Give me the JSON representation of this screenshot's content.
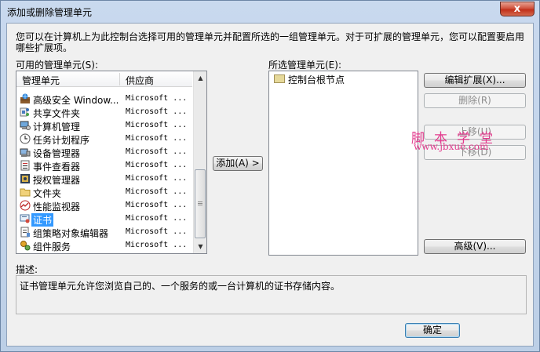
{
  "window": {
    "title": "添加或删除管理单元",
    "close_label": "x"
  },
  "intro": "您可以在计算机上为此控制台选择可用的管理单元并配置所选的一组管理单元。对于可扩展的管理单元，您可以配置要启用哪些扩展项。",
  "available": {
    "label": "可用的管理单元(S):",
    "columns": [
      "管理单元",
      "供应商"
    ],
    "items": [
      {
        "name": "高级安全 Window...",
        "vendor": "Microsoft ...",
        "icon": "firewall-icon"
      },
      {
        "name": "共享文件夹",
        "vendor": "Microsoft ...",
        "icon": "shared-folder-icon"
      },
      {
        "name": "计算机管理",
        "vendor": "Microsoft ...",
        "icon": "computer-management-icon"
      },
      {
        "name": "任务计划程序",
        "vendor": "Microsoft ...",
        "icon": "clock-icon"
      },
      {
        "name": "设备管理器",
        "vendor": "Microsoft ...",
        "icon": "device-manager-icon"
      },
      {
        "name": "事件查看器",
        "vendor": "Microsoft ...",
        "icon": "event-viewer-icon"
      },
      {
        "name": "授权管理器",
        "vendor": "Microsoft ...",
        "icon": "authorization-icon"
      },
      {
        "name": "文件夹",
        "vendor": "Microsoft ...",
        "icon": "folder-icon"
      },
      {
        "name": "性能监视器",
        "vendor": "Microsoft ...",
        "icon": "performance-icon"
      },
      {
        "name": "证书",
        "vendor": "Microsoft ...",
        "icon": "certificate-icon",
        "selected": true
      },
      {
        "name": "组策略对象编辑器",
        "vendor": "Microsoft ...",
        "icon": "group-policy-icon"
      },
      {
        "name": "组件服务",
        "vendor": "Microsoft ...",
        "icon": "component-services-icon"
      }
    ]
  },
  "add_button": "添加(A) >",
  "selected": {
    "label": "所选管理单元(E):",
    "root_node": "控制台根节点"
  },
  "buttons": {
    "edit_extensions": "编辑扩展(X)...",
    "remove": "删除(R)",
    "move_up": "上移(U)",
    "move_down": "下移(D)",
    "advanced": "高级(V)...",
    "ok": "确定"
  },
  "description": {
    "label": "描述:",
    "text": "证书管理单元允许您浏览自己的、一个服务的或一台计算机的证书存储内容。"
  },
  "watermark": {
    "line1": "脚本学堂",
    "line2": "www.jbxue.com"
  },
  "colors": {
    "selection": "#3399ff",
    "watermark": "#e23b8d",
    "close": "#c1301a"
  }
}
